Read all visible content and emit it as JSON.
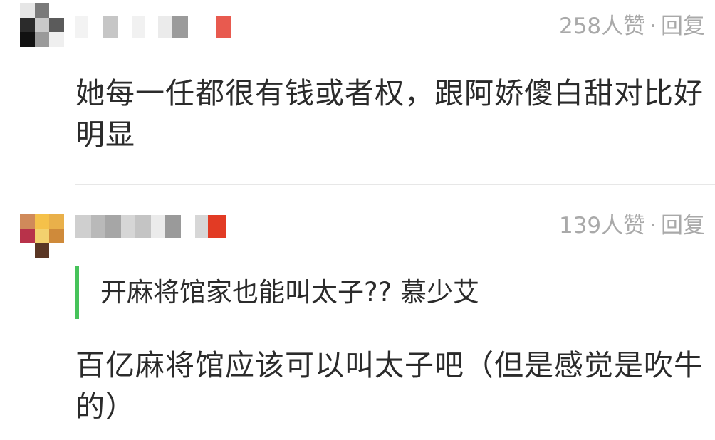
{
  "comments": [
    {
      "likes_text": "258人赞",
      "separator": "·",
      "reply_label": "回复",
      "text": "她每一任都很有钱或者权，跟阿娇傻白甜对比好明显",
      "avatar_colors": [
        "#e6e6e6",
        "#7a7a7a",
        "#ffffff",
        "#2b2b2b",
        "#c9c9c9",
        "#5b5b5b",
        "#111111",
        "#9a9a9a",
        "#efefef"
      ],
      "name_colors": [
        "#f3f3f3",
        "#ffffff",
        "#c6c6c6",
        "#ffffff",
        "#f1f1f1",
        "#ffffff",
        "#ebebeb",
        "#9b9b9b",
        "#ffffff",
        "#e85a4f"
      ]
    },
    {
      "likes_text": "139人赞",
      "separator": "·",
      "reply_label": "回复",
      "quote": "开麻将馆家也能叫太子?? 慕少艾",
      "text": "百亿麻将馆应该可以叫太子吧（但是感觉是吹牛的）",
      "avatar_colors": [
        "#d08a5a",
        "#f5c14a",
        "#e9b04a",
        "#b8324a",
        "#f3d16e",
        "#cf8a3a",
        "#ffffff",
        "#5a3624",
        "#ffffff"
      ],
      "name_colors": [
        "#cfcfcf",
        "#b9b9b9",
        "#a6a6a6",
        "#d6d6d6",
        "#c4c4c4",
        "#ebebeb",
        "#9a9a9a",
        "#ffffff",
        "#d7d7d7",
        "#e23b24"
      ]
    }
  ],
  "colors": {
    "quote_bar": "#46c35a",
    "meta_text": "#a9a9a9",
    "body_text": "#2b2b2b",
    "divider": "#e7e7e7"
  }
}
